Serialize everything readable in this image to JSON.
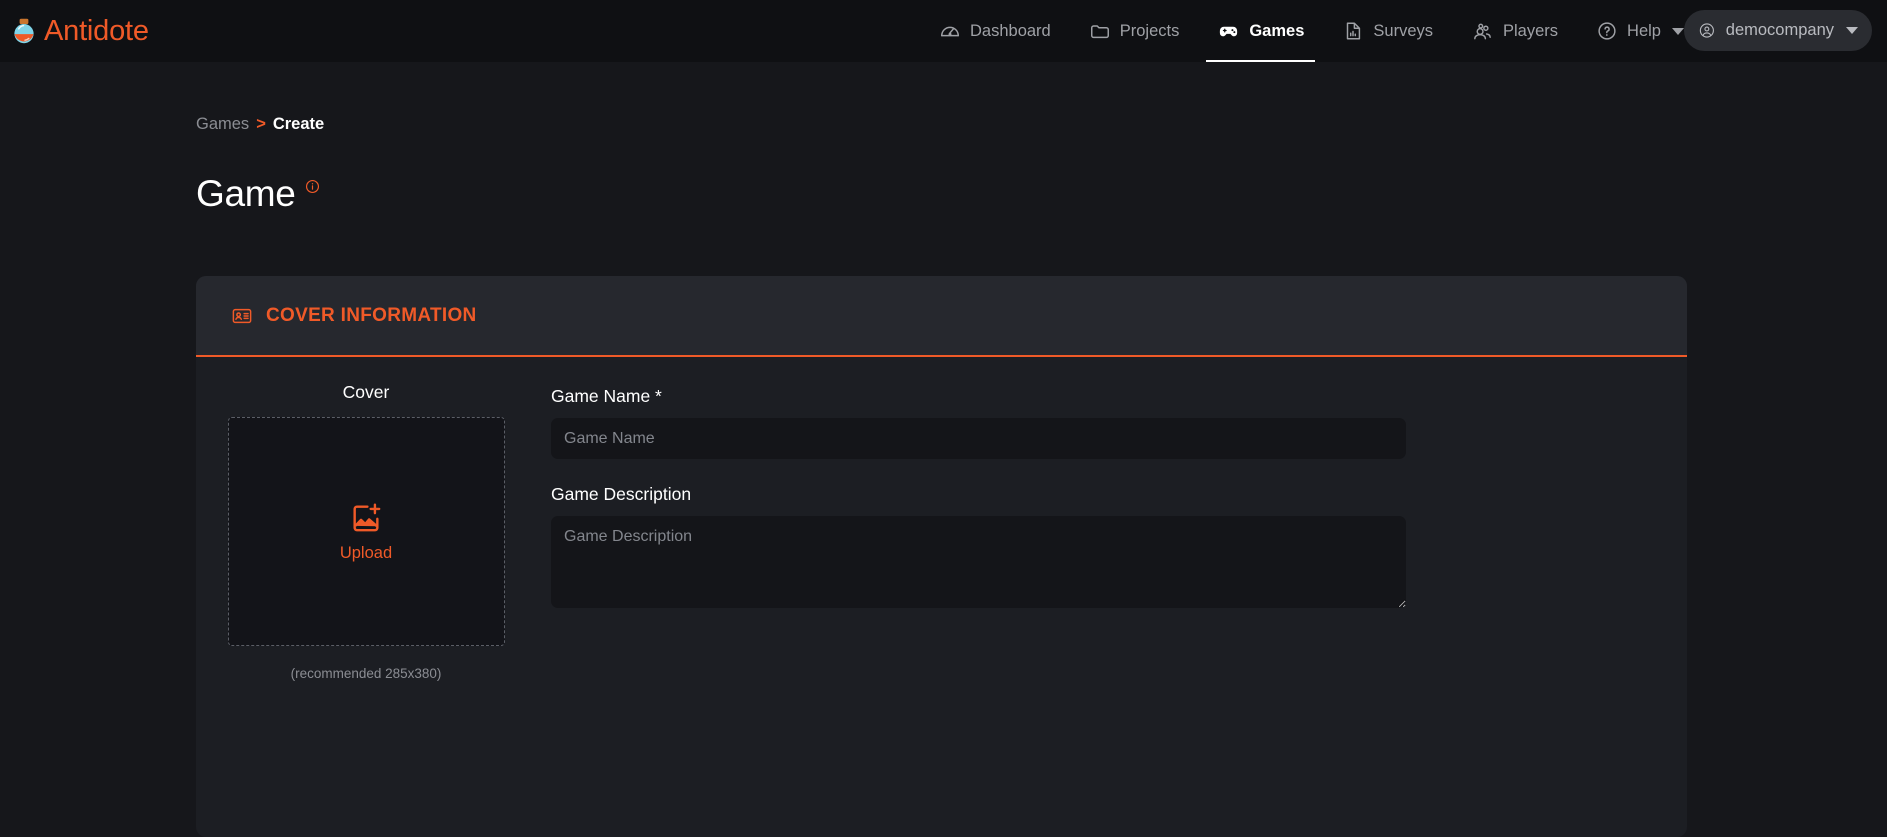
{
  "brand": {
    "name": "Antidote",
    "logo_icon": "potion-bottle-icon",
    "color": "#f05a28"
  },
  "nav": {
    "items": [
      {
        "label": "Dashboard",
        "icon": "speedometer-icon",
        "active": false
      },
      {
        "label": "Projects",
        "icon": "folder-icon",
        "active": false
      },
      {
        "label": "Games",
        "icon": "gamepad-icon",
        "active": true
      },
      {
        "label": "Surveys",
        "icon": "document-chart-icon",
        "active": false
      },
      {
        "label": "Players",
        "icon": "people-icon",
        "active": false
      },
      {
        "label": "Help",
        "icon": "question-circle-icon",
        "active": false
      }
    ],
    "help_caret": "chevron-down-icon",
    "account": {
      "label": "democompany",
      "icon": "user-circle-icon",
      "caret": "chevron-down-icon"
    }
  },
  "breadcrumb": {
    "parent": "Games",
    "separator": ">",
    "current": "Create"
  },
  "page": {
    "title": "Game",
    "info_icon": "info-circle-icon"
  },
  "card": {
    "header": {
      "title": "COVER INFORMATION",
      "icon": "id-card-icon"
    },
    "cover": {
      "label": "Cover",
      "upload_icon": "add-image-icon",
      "upload_text": "Upload",
      "hint": "(recommended 285x380)"
    },
    "fields": {
      "name": {
        "label": "Game Name *",
        "placeholder": "Game Name",
        "value": ""
      },
      "description": {
        "label": "Game Description",
        "placeholder": "Game Description",
        "value": ""
      }
    }
  },
  "colors": {
    "accent": "#f05a28",
    "page_bg": "#16171b",
    "card_bg": "#1c1e23",
    "header_bg": "#26282e"
  }
}
